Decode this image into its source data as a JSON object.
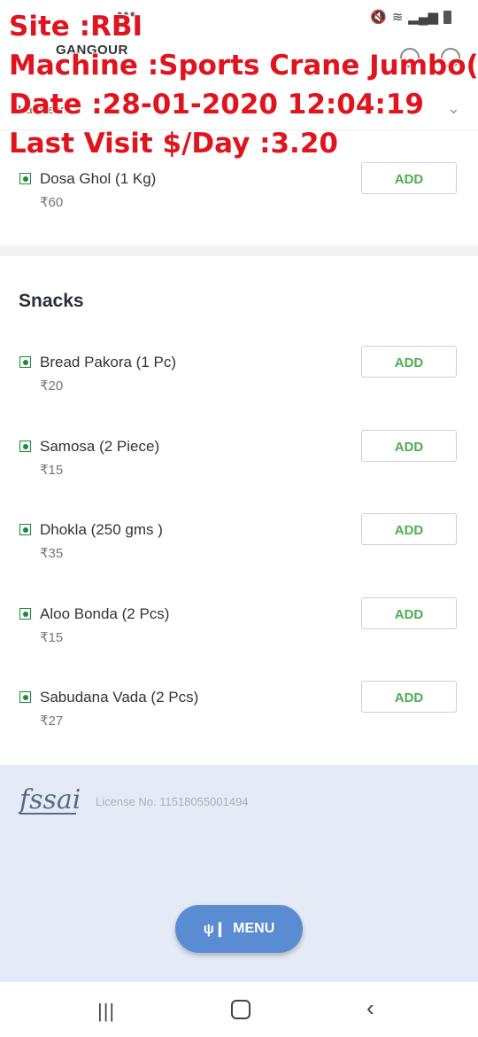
{
  "overlay": {
    "site": "Site :RBI",
    "machine": "Machine :Sports Crane Jumbo(",
    "date": "Date :28-01-2020 12:04:19",
    "last_visit": "Last Visit $/Day :3.20"
  },
  "status_bar": {
    "dots": "•••"
  },
  "header": {
    "store_name": "GANGOUR"
  },
  "tab": {
    "label": "Namkeen"
  },
  "items_top": [
    {
      "name": "Dosa Ghol (1 Kg)",
      "price": "₹60",
      "button": "ADD"
    }
  ],
  "section": {
    "title": "Snacks",
    "items": [
      {
        "name": "Bread Pakora (1 Pc)",
        "price": "₹20",
        "button": "ADD"
      },
      {
        "name": "Samosa (2 Piece)",
        "price": "₹15",
        "button": "ADD"
      },
      {
        "name": "Dhokla (250 gms )",
        "price": "₹35",
        "button": "ADD"
      },
      {
        "name": "Aloo Bonda (2 Pcs)",
        "price": "₹15",
        "button": "ADD"
      },
      {
        "name": "Sabudana Vada (2 Pcs)",
        "price": "₹27",
        "button": "ADD"
      }
    ]
  },
  "footer": {
    "logo_text": "fssai",
    "license": "License No. 11518055001494",
    "menu_button": "MENU"
  },
  "colors": {
    "overlay_text": "#e0141c",
    "add_text": "#4caf50",
    "veg_mark": "#1b8a3a",
    "menu_button_bg": "#5a8cd4",
    "footer_bg": "#e4ebf7"
  }
}
